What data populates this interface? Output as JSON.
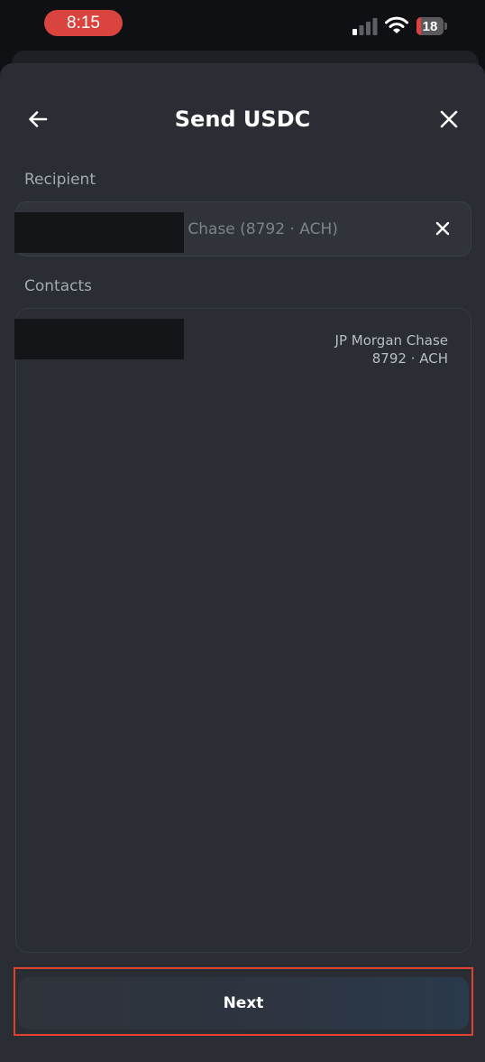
{
  "status_bar": {
    "time": "8:15",
    "battery_level": "18",
    "battery_fraction": 0.18,
    "icons": [
      "signal-icon",
      "wifi-icon",
      "battery-icon"
    ]
  },
  "header": {
    "title": "Send USDC",
    "back_icon": "arrow-left-icon",
    "close_icon": "close-icon"
  },
  "recipient": {
    "label": "Recipient",
    "value": "gan Chase (8792 · ACH)",
    "clear_icon": "close-icon"
  },
  "contacts": {
    "label": "Contacts",
    "items": [
      {
        "bank": "JP Morgan Chase",
        "account": "8792 · ACH"
      }
    ]
  },
  "footer": {
    "next_label": "Next"
  },
  "colors": {
    "sheet_background": "#2a2d33",
    "status_bar_background": "#0e1013",
    "time_pill": "#d9443f",
    "highlight_border": "#e0422f"
  }
}
